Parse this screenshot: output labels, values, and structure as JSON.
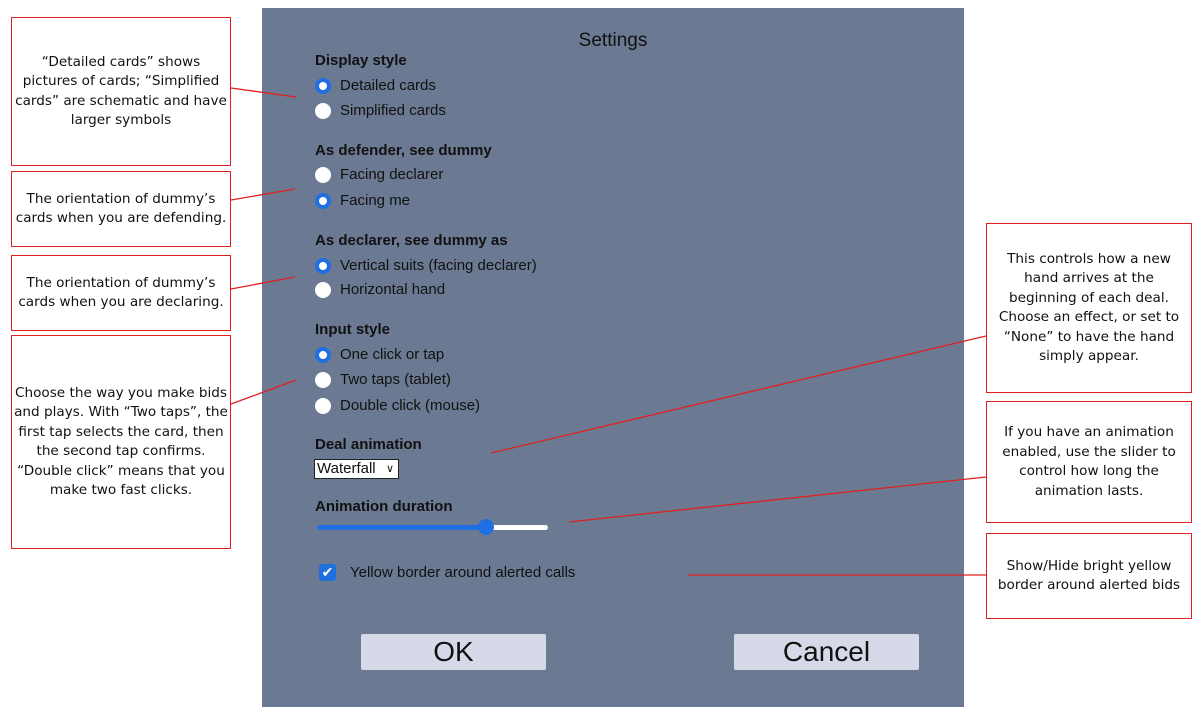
{
  "dialog": {
    "title": "Settings",
    "display_style": {
      "heading": "Display style",
      "options": [
        {
          "label": "Detailed cards",
          "selected": true
        },
        {
          "label": "Simplified cards",
          "selected": false
        }
      ]
    },
    "defender_dummy": {
      "heading": "As defender, see dummy",
      "options": [
        {
          "label": "Facing declarer",
          "selected": false
        },
        {
          "label": "Facing me",
          "selected": true
        }
      ]
    },
    "declarer_dummy": {
      "heading": "As declarer, see dummy as",
      "options": [
        {
          "label": "Vertical suits (facing declarer)",
          "selected": true
        },
        {
          "label": "Horizontal hand",
          "selected": false
        }
      ]
    },
    "input_style": {
      "heading": "Input style",
      "options": [
        {
          "label": "One click or tap",
          "selected": true
        },
        {
          "label": "Two taps (tablet)",
          "selected": false
        },
        {
          "label": "Double click (mouse)",
          "selected": false
        }
      ]
    },
    "deal_animation": {
      "heading": "Deal animation",
      "value": "Waterfall"
    },
    "animation_duration": {
      "heading": "Animation duration",
      "level": 0.73
    },
    "yellow_border": {
      "label": "Yellow border around alerted calls",
      "checked": true
    },
    "ok_label": "OK",
    "cancel_label": "Cancel"
  },
  "annotations": {
    "display_style": "“Detailed cards” shows pictures of cards; “Simplified cards” are schematic and have larger symbols",
    "defender_dummy": "The orientation of dummy’s cards when you are defending.",
    "declarer_dummy": "The orientation of dummy’s cards when you are declaring.",
    "input_style": "Choose the way you make bids and plays. With “Two taps”, the first tap selects the card, then the second tap confirms. “Double click” means that you make two fast clicks.",
    "deal_animation": "This controls how a new hand arrives at the beginning of each deal. Choose an effect, or set to “None” to have the hand simply appear.",
    "animation_duration": "If you have an animation enabled, use the slider to control how long the animation lasts.",
    "yellow_border": "Show/Hide bright yellow border around alerted bids"
  },
  "colors": {
    "panel": "#6b7a92",
    "accent": "#1f6fe0",
    "annotation_border": "#e02020",
    "button": "#d6dae8"
  }
}
